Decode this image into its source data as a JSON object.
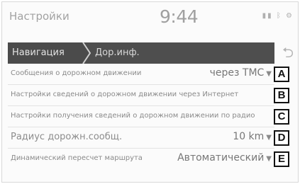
{
  "header": {
    "title": "Настройки",
    "time": "9:44",
    "status_icons": [
      "signal-icon",
      "bluetooth-icon",
      "settings-icon"
    ]
  },
  "breadcrumb": {
    "items": [
      {
        "label": "Навигация"
      },
      {
        "label": "Дор.инф."
      }
    ]
  },
  "settings": {
    "rows": [
      {
        "label": "Сообщения о дорожном движении",
        "value": "через TMC",
        "tag": "A"
      },
      {
        "label": "Настройки сведений о дорожном движении через Интернет",
        "value": "",
        "tag": "B"
      },
      {
        "label": "Настройки получения сведений о дорожном движении по радио",
        "value": "",
        "tag": "C"
      },
      {
        "label": "Радиус дорожн.сообщ.",
        "value": "10 km",
        "tag": "D"
      },
      {
        "label": "Динамический пересчет маршрута",
        "value": "Автоматический",
        "tag": "E"
      }
    ]
  },
  "colors": {
    "breadcrumb_bg": "#4e4e4e",
    "text_muted": "#8a8a8a"
  }
}
